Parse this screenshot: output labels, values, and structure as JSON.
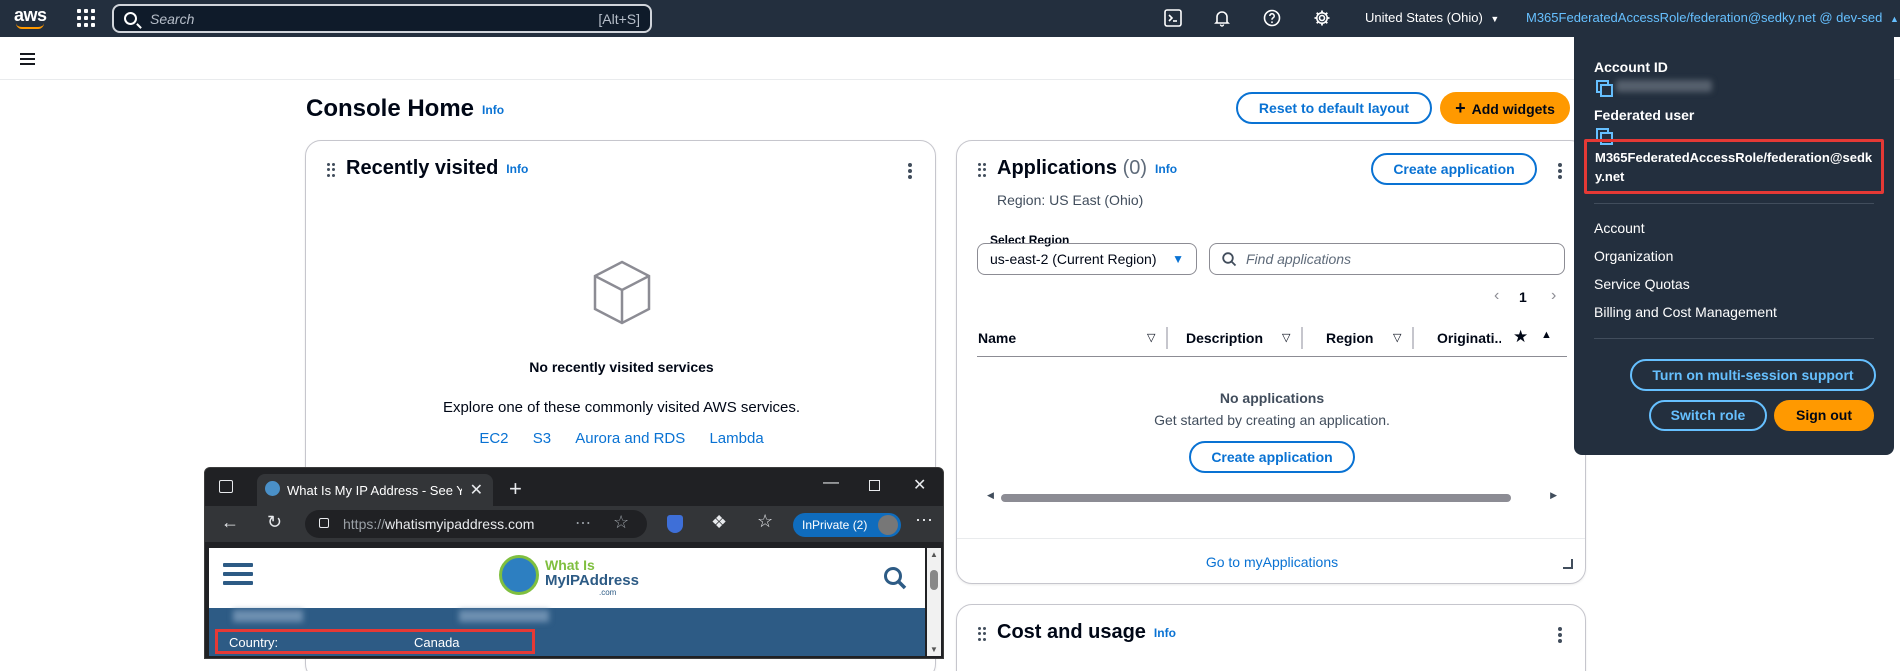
{
  "topnav": {
    "search_placeholder": "Search",
    "search_shortcut": "[Alt+S]",
    "region": "United States (Ohio)",
    "account": "M365FederatedAccessRole/federation@sedky.net @ dev-sed"
  },
  "page": {
    "title": "Console Home",
    "info": "Info",
    "reset_button": "Reset to default layout",
    "add_widgets_button": "Add widgets"
  },
  "recently_visited": {
    "title": "Recently visited",
    "info": "Info",
    "empty_title": "No recently visited services",
    "empty_text": "Explore one of these commonly visited AWS services.",
    "services": [
      "EC2",
      "S3",
      "Aurora and RDS",
      "Lambda"
    ]
  },
  "applications": {
    "title": "Applications",
    "count": "(0)",
    "info": "Info",
    "create_button": "Create application",
    "region_text": "Region: US East (Ohio)",
    "select_region_label": "Select Region",
    "select_region_value": "us-east-2 (Current Region)",
    "find_placeholder": "Find applications",
    "page_number": "1",
    "columns": [
      "Name",
      "Description",
      "Region",
      "Originati..."
    ],
    "empty_title": "No applications",
    "empty_text": "Get started by creating an application.",
    "empty_create_button": "Create application",
    "footer_link": "Go to myApplications"
  },
  "cost": {
    "title": "Cost and usage",
    "info": "Info"
  },
  "dropdown": {
    "account_id_label": "Account ID",
    "federated_user_label": "Federated user",
    "federated_user_value": "M365FederatedAccessRole/federation@sedky.net",
    "menu": [
      "Account",
      "Organization",
      "Service Quotas",
      "Billing and Cost Management"
    ],
    "multi_session_button": "Turn on multi-session support",
    "switch_role_button": "Switch role",
    "sign_out_button": "Sign out"
  },
  "browser": {
    "tab_title": "What Is My IP Address - See Your",
    "url_prefix": "https://",
    "url_domain": "whatismyipaddress.com",
    "inprivate": "InPrivate (2)",
    "site_logo_line1": "What Is",
    "site_logo_line2": "MyIPAddress",
    "site_logo_line3": ".com",
    "country_label": "Country:",
    "country_value": "Canada"
  },
  "colors": {
    "nav_bg": "#232f3e",
    "link": "#0972d3",
    "accent": "#ff9900",
    "highlight": "#e53935"
  }
}
